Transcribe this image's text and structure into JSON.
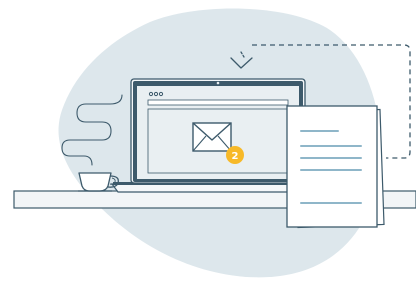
{
  "illustration": {
    "notification_count": "2",
    "browser_window_dots": 3,
    "colors": {
      "blob": "#dde7ec",
      "outline": "#3d5a6b",
      "screen_fill": "#e9eff2",
      "laptop_body": "#f4f7f9",
      "badge": "#f7b928",
      "badge_text": "#ffffff",
      "paper": "#ffffff",
      "paper_lines": "#8fb6c9",
      "desk": "#f2f5f7"
    },
    "icons": {
      "envelope": "envelope-icon",
      "arrow": "download-arrow-icon",
      "cup": "coffee-cup-icon",
      "steam": "steam-icon",
      "document": "document-icon"
    }
  }
}
